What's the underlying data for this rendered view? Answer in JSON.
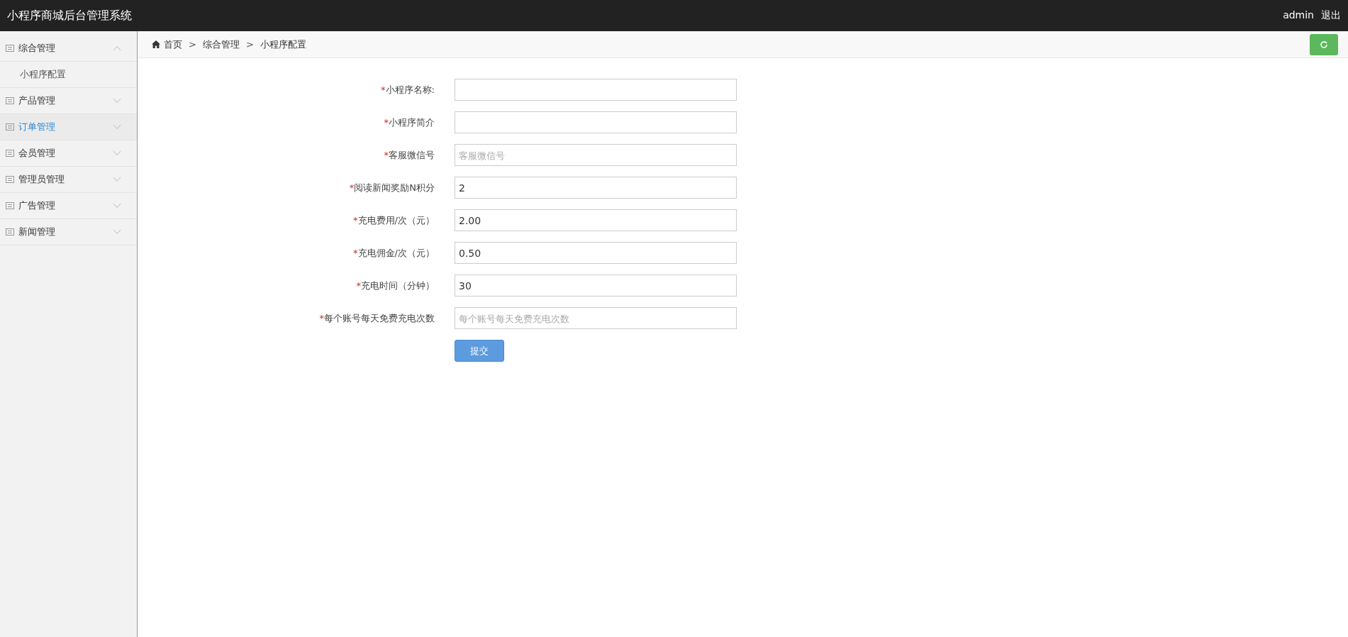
{
  "header": {
    "title": "小程序商城后台管理系统",
    "user": "admin",
    "logout": "退出"
  },
  "sidebar": {
    "items": [
      {
        "label": "综合管理",
        "expanded": true,
        "selected": false,
        "children": [
          {
            "label": "小程序配置"
          }
        ]
      },
      {
        "label": "产品管理",
        "expanded": false,
        "selected": false
      },
      {
        "label": "订单管理",
        "expanded": false,
        "selected": true
      },
      {
        "label": "会员管理",
        "expanded": false,
        "selected": false
      },
      {
        "label": "管理员管理",
        "expanded": false,
        "selected": false
      },
      {
        "label": "广告管理",
        "expanded": false,
        "selected": false
      },
      {
        "label": "新闻管理",
        "expanded": false,
        "selected": false
      }
    ]
  },
  "breadcrumb": {
    "items": [
      "首页",
      "综合管理",
      "小程序配置"
    ],
    "separator": ">"
  },
  "form": {
    "required_mark": "*",
    "fields": [
      {
        "label": "小程序名称:",
        "required": true
      },
      {
        "label": "小程序简介",
        "required": true
      },
      {
        "label": "客服微信号",
        "required": true,
        "placeholder": "客服微信号"
      },
      {
        "label": "阅读新闻奖励N积分",
        "required": true,
        "value": "2"
      },
      {
        "label": "充电费用/次（元）",
        "required": true,
        "value": "2.00"
      },
      {
        "label": "充电佣金/次（元）",
        "required": true,
        "value": "0.50"
      },
      {
        "label": "充电时间（分钟）",
        "required": true,
        "value": "30"
      },
      {
        "label": "每个账号每天免费充电次数",
        "required": true,
        "placeholder": "每个账号每天免费充电次数"
      }
    ],
    "submit": "提交"
  }
}
